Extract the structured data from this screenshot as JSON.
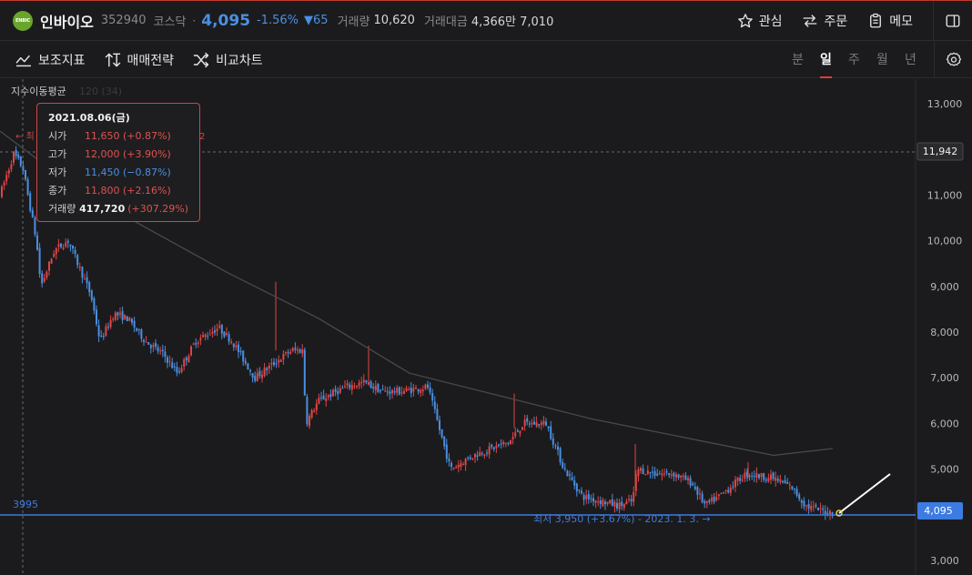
{
  "header": {
    "logo_text": "ENBIC",
    "name": "인바이오",
    "code": "352940",
    "market": "코스닥",
    "separator": "·",
    "price": "4,095",
    "change_pct": "-1.56%",
    "change_abs": "▼65",
    "volume_label": "거래량",
    "volume": "10,620",
    "amount_label": "거래대금",
    "amount": "4,366만 7,010",
    "watch_label": "관심",
    "order_label": "주문",
    "memo_label": "메모"
  },
  "toolbar": {
    "indicator_label": "보조지표",
    "strategy_label": "매매전략",
    "compare_label": "비교차트",
    "periods": [
      "분",
      "일",
      "주",
      "월",
      "년"
    ],
    "active_period": "일"
  },
  "chart": {
    "legend_label": "지수이동평균",
    "legend_params": "120 (34)",
    "y_ticks": [
      "13,000",
      "12,000",
      "11,000",
      "10,000",
      "9,000",
      "8,000",
      "7,000",
      "6,000",
      "5,000",
      "4,000",
      "3,000"
    ],
    "crosshair_value": "11,942",
    "current_price_label": "4,095",
    "horizontal_line_label": "3995",
    "high_annotation_prefix": "← 최",
    "high_annotation_suffix": "2",
    "low_annotation": "최저 3,950 (+3.67%) - 2023. 1. 3. →",
    "colors": {
      "up": "#e04545",
      "down": "#4a8fe0",
      "hline": "#3d7be0",
      "ma": "#4a4a4e"
    }
  },
  "tooltip": {
    "date": "2021.08.06(금)",
    "rows": [
      {
        "label": "시가",
        "value": "11,650 (+0.87%)"
      },
      {
        "label": "고가",
        "value": "12,000 (+3.90%)"
      },
      {
        "label": "저가",
        "value": "11,450 (−0.87%)"
      },
      {
        "label": "종가",
        "value": "11,800 (+2.16%)"
      }
    ],
    "volume_label": "거래량",
    "volume_value": "417,720",
    "volume_change": "(+307.29%)"
  }
}
